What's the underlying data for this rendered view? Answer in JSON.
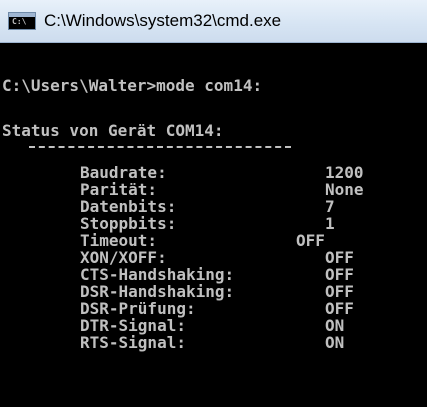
{
  "window": {
    "title": "C:\\Windows\\system32\\cmd.exe",
    "icon_text": "C:\\"
  },
  "console": {
    "prompt_line": "C:\\Users\\Walter>mode com14:",
    "status_line": "Status von Gerät COM14:",
    "separator": "-----------------------",
    "rows": [
      {
        "label": "Baudrate:",
        "value": "1200"
      },
      {
        "label": "Parität:",
        "value": "None"
      },
      {
        "label": "Datenbits:",
        "value": "7"
      },
      {
        "label": "Stoppbits:",
        "value": "1"
      },
      {
        "label": "Timeout:",
        "value": "OFF"
      },
      {
        "label": "XON/XOFF:",
        "value": "OFF"
      },
      {
        "label": "CTS-Handshaking:",
        "value": "OFF"
      },
      {
        "label": "DSR-Handshaking:",
        "value": "OFF"
      },
      {
        "label": "DSR-Prüfung:",
        "value": "OFF"
      },
      {
        "label": "DTR-Signal:",
        "value": "ON"
      },
      {
        "label": "RTS-Signal:",
        "value": "ON"
      }
    ]
  },
  "colors": {
    "console_background": "#000000",
    "console_text": "#c0c0c0",
    "titlebar": "#d6e4f3"
  }
}
